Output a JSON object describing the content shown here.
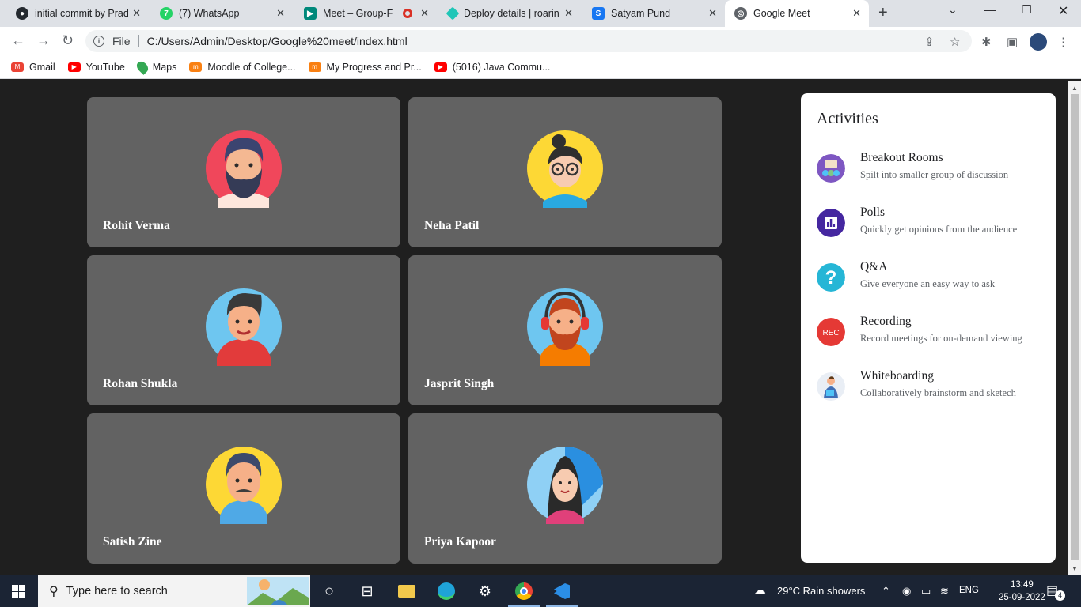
{
  "browser": {
    "tabs": [
      {
        "title": "initial commit by Prad",
        "favicon": "github-icon",
        "color": "#24292f"
      },
      {
        "title": "(7) WhatsApp",
        "favicon": "whatsapp-icon",
        "color": "#25d366"
      },
      {
        "title": "Meet – Group-F",
        "favicon": "google-meet-icon",
        "color": "#00897b"
      },
      {
        "title": "Deploy details | roarin",
        "favicon": "netlify-icon",
        "color": "#20c6b7"
      },
      {
        "title": "Satyam Pund",
        "favicon": "facebook-icon",
        "color": "#1877f2"
      },
      {
        "title": "Google Meet",
        "favicon": "globe-icon",
        "color": "#5f6368"
      }
    ],
    "omnibox": {
      "scheme_label": "File",
      "url": "C:/Users/Admin/Desktop/Google%20meet/index.html"
    },
    "bookmarks": [
      {
        "label": "Gmail",
        "icon": "gmail-icon",
        "color": "#ea4335"
      },
      {
        "label": "YouTube",
        "icon": "youtube-icon",
        "color": "#ff0000"
      },
      {
        "label": "Maps",
        "icon": "maps-icon",
        "color": "#34a853"
      },
      {
        "label": "Moodle of College...",
        "icon": "moodle-icon",
        "color": "#f98012"
      },
      {
        "label": "My Progress and Pr...",
        "icon": "moodle-icon",
        "color": "#f98012"
      },
      {
        "label": "(5016) Java Commu...",
        "icon": "youtube-icon",
        "color": "#ff0000"
      }
    ]
  },
  "participants": [
    {
      "name": "Rohit Verma"
    },
    {
      "name": "Neha Patil"
    },
    {
      "name": "Rohan Shukla"
    },
    {
      "name": "Jasprit Singh"
    },
    {
      "name": "Satish Zine"
    },
    {
      "name": "Priya Kapoor"
    }
  ],
  "activities": {
    "title": "Activities",
    "items": [
      {
        "name": "Breakout Rooms",
        "desc": "Spilt into smaller group of discussion",
        "icon": "breakout-rooms-icon",
        "color": "#7e57c2"
      },
      {
        "name": "Polls",
        "desc": "Quickly get opinions from the audience",
        "icon": "polls-icon",
        "color": "#4527a0"
      },
      {
        "name": "Q&A",
        "desc": "Give everyone an easy way to ask",
        "icon": "question-icon",
        "color": "#26b6d6"
      },
      {
        "name": "Recording",
        "desc": "Record meetings for on-demand viewing",
        "icon": "rec-icon",
        "icon_text": "REC",
        "color": "#e53935"
      },
      {
        "name": "Whiteboarding",
        "desc": "Collaboratively brainstorm and sketech",
        "icon": "whiteboard-icon",
        "color": "#3f6fb6"
      }
    ]
  },
  "taskbar": {
    "search_placeholder": "Type here to search",
    "weather": "29°C  Rain showers",
    "language": "ENG",
    "time": "13:49",
    "date": "25-09-2022",
    "notification_count": "4"
  }
}
